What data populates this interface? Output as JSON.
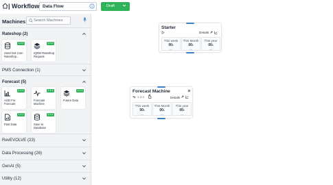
{
  "header": {
    "app_title": "| Workflow",
    "flow_name": "Data Flow",
    "status_button": "Draft"
  },
  "sidebar": {
    "title": "Machines",
    "search_placeholder": "Search Machines",
    "categories": [
      {
        "label": "Rateshop (2)",
        "expanded": true,
        "items": [
          {
            "label": "Hotel Dot Com Rateshop...",
            "badge": "1.0.0",
            "icon": "database-icon"
          },
          {
            "label": "IQRM Rateshop Request",
            "badge": "1.0.0",
            "icon": "layers-icon"
          }
        ]
      },
      {
        "label": "PMS Connection (1)",
        "expanded": false
      },
      {
        "label": "Forecast (5)",
        "expanded": true,
        "items": [
          {
            "label": "AOD For Forecast",
            "badge": "1.1.1",
            "icon": "bar-chart-icon"
          },
          {
            "label": "Forecast Machine",
            "badge": "1.1.1",
            "icon": "pulse-icon"
          },
          {
            "label": "Future Data",
            "badge": "1.1.1",
            "icon": "layers-icon"
          },
          {
            "label": "Past Data",
            "badge": "1.1.1",
            "icon": "file-chart-icon"
          },
          {
            "label": "Save to Database",
            "badge": "1.0.1",
            "icon": "database-icon"
          }
        ]
      },
      {
        "label": "RevEVOLVE (23)",
        "expanded": false
      },
      {
        "label": "Data Processing (26)",
        "expanded": false
      },
      {
        "label": "GenAI (5)",
        "expanded": false
      },
      {
        "label": "Utility (12)",
        "expanded": false
      }
    ]
  },
  "canvas": {
    "nodes": [
      {
        "title": "Starter",
        "subtitle": "",
        "details_label": "Details",
        "metrics": [
          {
            "label": "This week",
            "value": "00",
            "unit": "s",
            "sub": "---"
          },
          {
            "label": "This Month",
            "value": "00",
            "unit": "s",
            "sub": "---"
          },
          {
            "label": "This year",
            "value": "00",
            "unit": "s",
            "sub": "---"
          }
        ]
      },
      {
        "title": "Forecast Machine",
        "subtitle": "1.2.1",
        "details_label": "Details",
        "metrics": [
          {
            "label": "This week",
            "value": "00",
            "unit": "s",
            "sub": "---"
          },
          {
            "label": "This Month",
            "value": "00",
            "unit": "s",
            "sub": "---"
          },
          {
            "label": "This year",
            "value": "00",
            "unit": "s",
            "sub": "---"
          }
        ]
      }
    ]
  },
  "colors": {
    "accent_green": "#2fb35a",
    "handle_blue": "#3b82c4",
    "sidebar_bg": "#f1f3f5"
  }
}
